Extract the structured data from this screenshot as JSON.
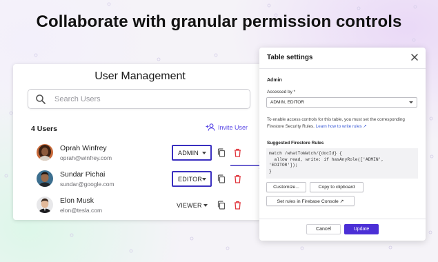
{
  "headline": "Collaborate with granular permission controls",
  "colors": {
    "accent": "#4b2fd6",
    "link": "#5b4ae6",
    "danger": "#e0333a"
  },
  "user_management": {
    "title": "User Management",
    "search_placeholder": "Search Users",
    "count_label": "4 Users",
    "invite_label": "Invite User",
    "users": [
      {
        "name": "Oprah Winfrey",
        "email": "oprah@winfrey.com",
        "role": "ADMIN",
        "active": true
      },
      {
        "name": "Sundar Pichai",
        "email": "sundar@google.com",
        "role": "EDITOR",
        "active": true
      },
      {
        "name": "Elon Musk",
        "email": "elon@tesla.com",
        "role": "VIEWER",
        "active": false
      }
    ]
  },
  "table_settings": {
    "title": "Table settings",
    "section": "Admin",
    "accessed_by_label": "Accessed by *",
    "accessed_by_value": "ADMIN, EDITOR",
    "info_text": "To enable access controls for this table, you must set the corresponding Firestore Security Rules.",
    "info_link": "Learn how to write rules ↗",
    "rules_label": "Suggested Firestore Rules",
    "code": "match /whatToWatch/{docId} {\n  allow read, write: if hasAnyRole(['ADMIN',\n'EDITOR']);\n}",
    "customize_label": "Customize...",
    "copy_label": "Copy to clipboard",
    "set_rules_label": "Set rules in Firebase Console ↗",
    "cancel_label": "Cancel",
    "update_label": "Update"
  }
}
